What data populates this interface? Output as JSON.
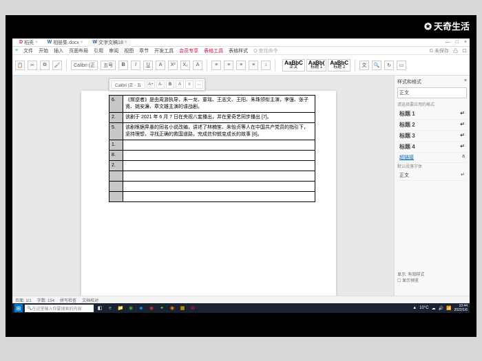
{
  "watermark": "天奇生活",
  "tabs": [
    {
      "label": "稻壳",
      "icon": "D"
    },
    {
      "label": "相册集.docx",
      "icon": "W"
    },
    {
      "label": "文字文稿18",
      "icon": "W",
      "active": true
    }
  ],
  "menu": [
    "文件",
    "开始",
    "插入",
    "页面布局",
    "引用",
    "审阅",
    "视图",
    "章节",
    "开发工具",
    "会员专享",
    "表格工具",
    "表格样式",
    "Q 查找命令"
  ],
  "menu_right": [
    "G 未保存",
    "凸",
    "口"
  ],
  "font": {
    "name": "Calibri (正",
    "size": "五号"
  },
  "style_previews": [
    {
      "sample": "AaBbC",
      "name": "正文"
    },
    {
      "sample": "AaBb(",
      "name": "标题 1"
    },
    {
      "sample": "AaBbC",
      "name": "标题 2"
    }
  ],
  "float_toolbar_font": "Calibri (正 · 五",
  "table_rows": [
    {
      "num": "6.",
      "text": "《叛逆者》是由周游执导，朱一龙、童瑶、王志文、王阳、朱珠领衔主演，李强、张子贤、姚安濂、章文雄主演的谍战剧。"
    },
    {
      "num": "2.",
      "text": "该剧于 2021 年 6 月 7 日在央视八套播出，并在爱奇艺同步播出 [7]。"
    },
    {
      "num": "5.",
      "text": "该剧根据畀愚的同名小说改编，讲述了林楠笙、朱怡贞等人在中国共产党员的指引下，坚持理想，寻找正确的救国道路，完成信仰蜕变成长的故事 [8]。"
    },
    {
      "num": "1.",
      "text": ""
    },
    {
      "num": "8.",
      "text": ""
    },
    {
      "num": "2.",
      "text": ""
    },
    {
      "num": "",
      "text": ""
    },
    {
      "num": "",
      "text": ""
    },
    {
      "num": "",
      "text": ""
    }
  ],
  "sidepanel": {
    "title": "样式和格式",
    "current": "正文",
    "section_label": "请选择要应用的格式",
    "styles": [
      "标题 1",
      "标题 2",
      "标题 3",
      "标题 4"
    ],
    "link_style": "超链接",
    "default_font_label": "默认段落字体",
    "body_style": "正文",
    "footer1": "显示: 有效样式",
    "footer2": "☐ 显示预览"
  },
  "statusbar": {
    "page": "页面: 1/1",
    "words": "字数: 154",
    "spell": "拼写检查",
    "doc_check": "文档校对"
  },
  "taskbar": {
    "search_placeholder": "在这里输入你要搜索的内容",
    "weather": "10°C",
    "time": "10:44",
    "date": "2022/1/6"
  }
}
